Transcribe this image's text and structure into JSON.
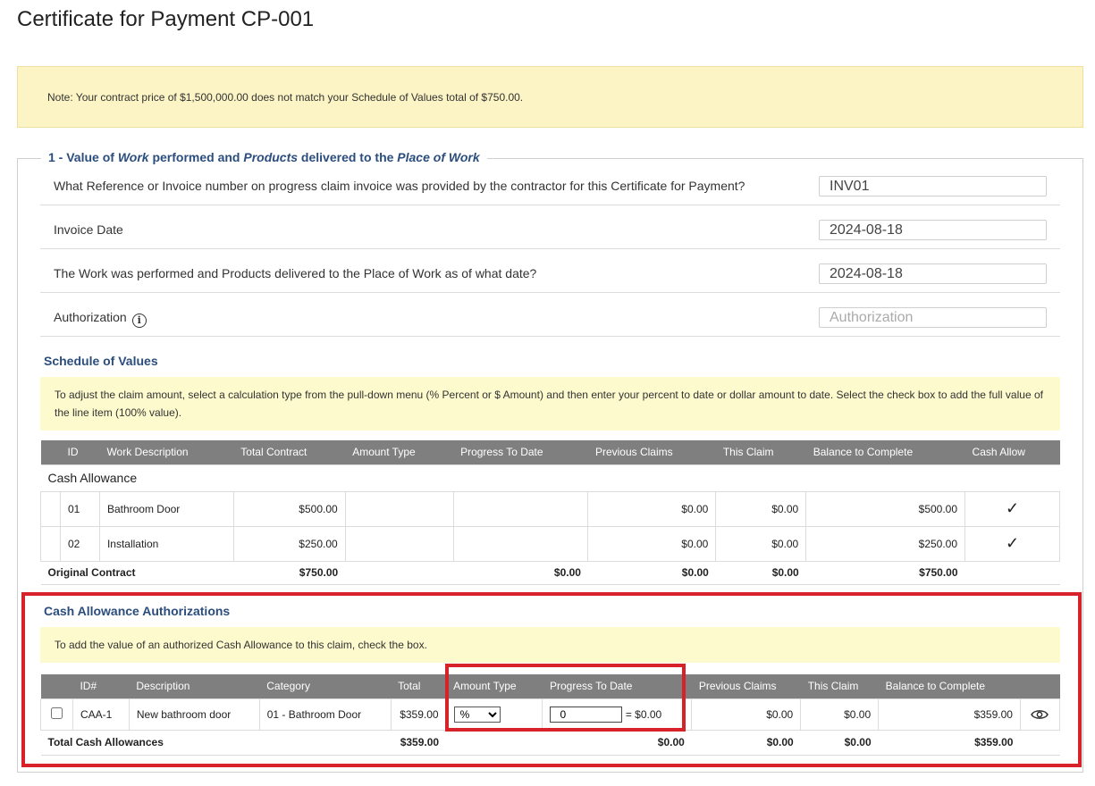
{
  "page": {
    "title": "Certificate for Payment CP-001"
  },
  "note": "Note: Your contract price of $1,500,000.00 does not match your Schedule of Values total of $750.00.",
  "section1": {
    "legend_prefix": "1 - Value of ",
    "legend_work": "Work",
    "legend_mid1": " performed and ",
    "legend_products": "Products",
    "legend_mid2": " delivered to the ",
    "legend_place": "Place of Work",
    "fields": [
      {
        "label": "What Reference or Invoice number on progress claim invoice was provided by the contractor for this Certificate for Payment?",
        "value": "INV01",
        "placeholder": ""
      },
      {
        "label": "Invoice Date",
        "value": "2024-08-18",
        "placeholder": ""
      },
      {
        "label": "The Work was performed and Products delivered to the Place of Work as of what date?",
        "value": "2024-08-18",
        "placeholder": ""
      },
      {
        "label": "Authorization",
        "value": "",
        "placeholder": "Authorization"
      }
    ]
  },
  "sov": {
    "title": "Schedule of Values",
    "instructions": "To adjust the claim amount, select a calculation type from the pull-down menu (% Percent or $ Amount) and then enter your percent to date or dollar amount to date. Select the check box to add the full value of the line item (100% value).",
    "headers": [
      "ID",
      "Work Description",
      "Total Contract",
      "Amount Type",
      "Progress To Date",
      "Previous Claims",
      "This Claim",
      "Balance to Complete",
      "Cash Allow"
    ],
    "group_label": "Cash Allowance",
    "rows": [
      {
        "id": "01",
        "desc": "Bathroom Door",
        "total": "$500.00",
        "previous": "$0.00",
        "this_claim": "$0.00",
        "balance": "$500.00",
        "cash_allow": "✓"
      },
      {
        "id": "02",
        "desc": "Installation",
        "total": "$250.00",
        "previous": "$0.00",
        "this_claim": "$0.00",
        "balance": "$250.00",
        "cash_allow": "✓"
      }
    ],
    "total_row": {
      "label": "Original Contract",
      "total": "$750.00",
      "progress": "$0.00",
      "previous": "$0.00",
      "this_claim": "$0.00",
      "balance": "$750.00"
    }
  },
  "caa": {
    "title": "Cash Allowance Authorizations",
    "instructions": "To add the value of an authorized Cash Allowance to this claim, check the box.",
    "headers": [
      "ID#",
      "Description",
      "Category",
      "Total",
      "Amount Type",
      "Progress To Date",
      "Previous Claims",
      "This Claim",
      "Balance to Complete"
    ],
    "row": {
      "id": "CAA-1",
      "desc": "New bathroom door",
      "category": "01 - Bathroom Door",
      "total": "$359.00",
      "amount_type": "%",
      "amount_type_options": [
        "%",
        "$"
      ],
      "progress_value": "0",
      "progress_result": "= $0.00",
      "previous": "$0.00",
      "this_claim": "$0.00",
      "balance": "$359.00"
    },
    "total_row": {
      "label": "Total Cash Allowances",
      "total": "$359.00",
      "progress": "$0.00",
      "previous": "$0.00",
      "this_claim": "$0.00",
      "balance": "$359.00"
    }
  },
  "colors": {
    "highlight_red": "#d8222a",
    "section_blue": "#2b4d7e",
    "note_yellow": "#fcf4c4",
    "header_gray": "#7f7f7f"
  }
}
